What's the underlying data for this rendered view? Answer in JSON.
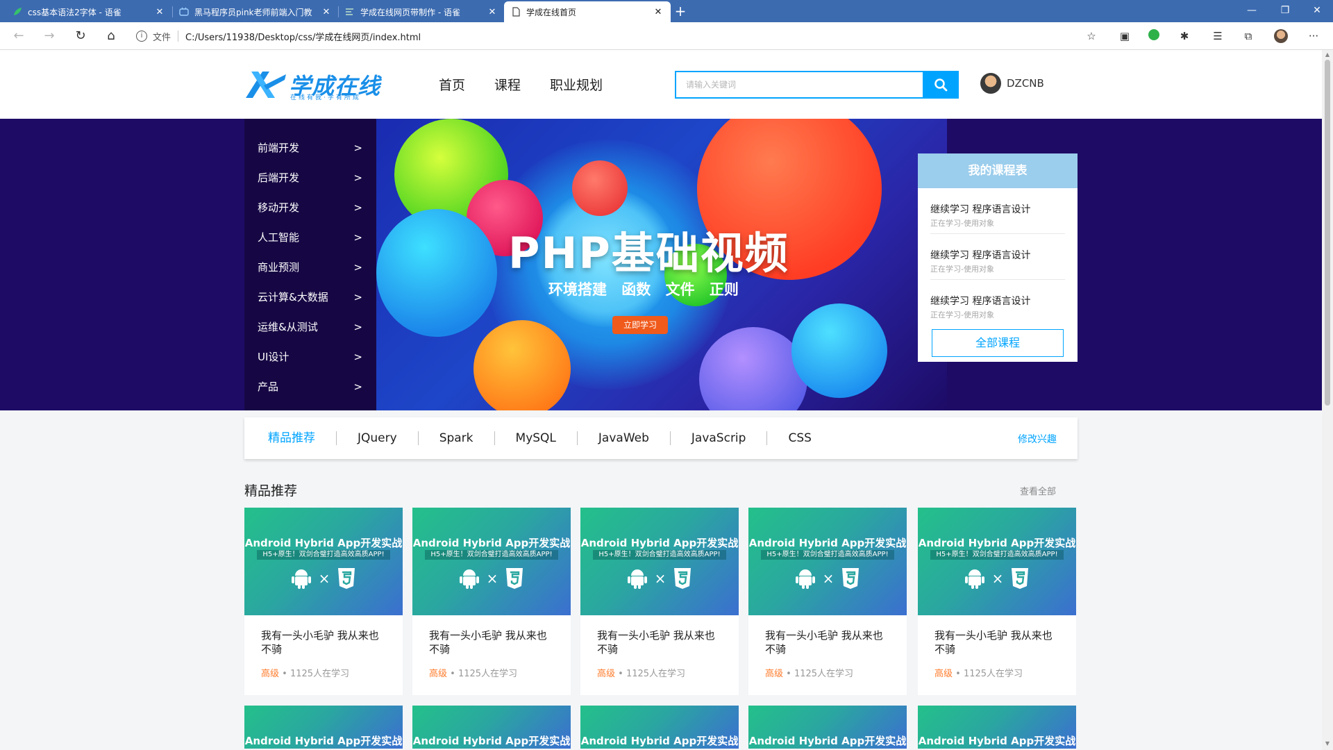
{
  "browser": {
    "tabs": [
      {
        "title": "css基本语法2字体 - 语雀",
        "active": false
      },
      {
        "title": "黑马程序员pink老师前端入门教",
        "active": false
      },
      {
        "title": "学成在线网页带制作 - 语雀",
        "active": false
      },
      {
        "title": "学成在线首页",
        "active": true
      }
    ],
    "url_label": "文件",
    "url": "C:/Users/11938/Desktop/css/学成在线网页/index.html"
  },
  "header": {
    "logo_text": "学成在线",
    "logo_sub": "在线有我·学有所成",
    "nav": [
      "首页",
      "课程",
      "职业规划"
    ],
    "search_placeholder": "请输入关键词",
    "user_name": "DZCNB"
  },
  "banner": {
    "title": "PHP基础视频",
    "subtitle": "环境搭建 函数 文件 正则",
    "button": "立即学习"
  },
  "sidenav": {
    "items": [
      "前端开发",
      "后端开发",
      "移动开发",
      "人工智能",
      "商业预测",
      "云计算&大数据",
      "运维&从测试",
      "UI设计",
      "产品"
    ],
    "arrow": ">"
  },
  "schedule": {
    "title": "我的课程表",
    "items": [
      {
        "main": "继续学习 程序语言设计",
        "sub": "正在学习-使用对象"
      },
      {
        "main": "继续学习 程序语言设计",
        "sub": "正在学习-使用对象"
      },
      {
        "main": "继续学习 程序语言设计",
        "sub": "正在学习-使用对象"
      }
    ],
    "button": "全部课程"
  },
  "categories": {
    "items": [
      "精品推荐",
      "JQuery",
      "Spark",
      "MySQL",
      "JavaWeb",
      "JavaScrip",
      "CSS"
    ],
    "edit": "修改兴趣"
  },
  "section": {
    "title": "精品推荐",
    "more": "查看全部"
  },
  "course_image": {
    "title": "Android Hybrid App开发实战",
    "sub": "H5+原生！双剑合璧打造高效高质APP!",
    "times": "×"
  },
  "courses": [
    {
      "name": "我有一头小毛驴 我从来也不骑",
      "level": "高级",
      "sep": " • ",
      "learners": "1125人在学习"
    },
    {
      "name": "我有一头小毛驴 我从来也不骑",
      "level": "高级",
      "sep": " • ",
      "learners": "1125人在学习"
    },
    {
      "name": "我有一头小毛驴 我从来也不骑",
      "level": "高级",
      "sep": " • ",
      "learners": "1125人在学习"
    },
    {
      "name": "我有一头小毛驴 我从来也不骑",
      "level": "高级",
      "sep": " • ",
      "learners": "1125人在学习"
    },
    {
      "name": "我有一头小毛驴 我从来也不骑",
      "level": "高级",
      "sep": " • ",
      "learners": "1125人在学习"
    }
  ],
  "colors": {
    "accent": "#00a4ff",
    "level": "#ff7c2d",
    "banner_bg": "#1d0b66",
    "tabbar": "#3c6bb0"
  }
}
